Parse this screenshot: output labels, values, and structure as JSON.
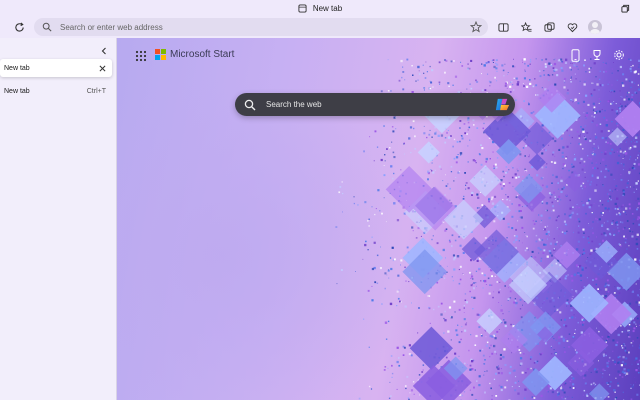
{
  "window": {
    "title": "New tab",
    "title_icon": "tab-page-icon",
    "restore_icon": "restore-icon"
  },
  "toolbar": {
    "refresh_icon": "refresh-icon",
    "address_placeholder": "Search or enter web address",
    "address_value": "",
    "favorite_icon": "star-icon",
    "right_icons": [
      "split-screen-icon",
      "favorites-icon",
      "collections-icon",
      "browser-essentials-icon",
      "profile-avatar"
    ]
  },
  "tabs_panel": {
    "collapse_icon": "chevron-left-icon",
    "active_tab": {
      "label": "New tab",
      "close_icon": "close-icon"
    },
    "new_tab": {
      "label": "New tab",
      "shortcut": "Ctrl+T"
    }
  },
  "content": {
    "brand": "Microsoft Start",
    "apps_icon": "app-launcher-icon",
    "top_right_icons": [
      "phone-icon",
      "rewards-icon",
      "settings-icon"
    ],
    "search_placeholder": "Search the web",
    "copilot_icon": "copilot-icon",
    "colors": {
      "ms_red": "#f25022",
      "ms_green": "#7fba00",
      "ms_blue": "#00a4ef",
      "ms_yellow": "#ffb900",
      "search_bg": "#3e3e46"
    }
  }
}
